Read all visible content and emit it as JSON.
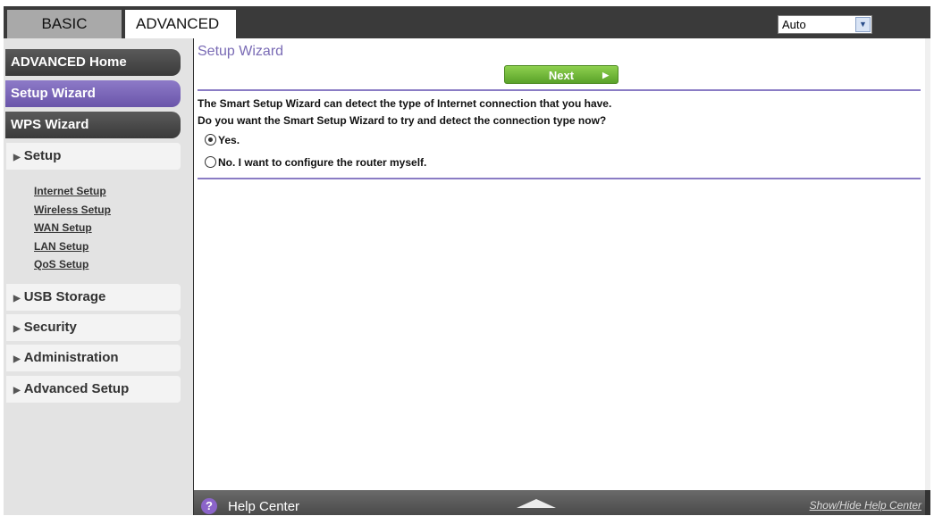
{
  "tabs": {
    "basic": "BASIC",
    "advanced": "ADVANCED"
  },
  "language_select": {
    "value": "Auto"
  },
  "sidebar": {
    "advanced_home": "ADVANCED Home",
    "setup_wizard": "Setup Wizard",
    "wps_wizard": "WPS Wizard",
    "setup": "Setup",
    "setup_items": [
      "Internet Setup",
      "Wireless Setup",
      "WAN Setup",
      "LAN Setup",
      "QoS Setup"
    ],
    "usb_storage": "USB Storage",
    "security": "Security",
    "administration": "Administration",
    "advanced_setup": "Advanced Setup"
  },
  "main": {
    "title": "Setup Wizard",
    "next_label": "Next",
    "description_1": "The Smart Setup Wizard can detect the type of Internet connection that you have.",
    "description_2": "Do you want the Smart Setup Wizard to try and detect the connection type now?",
    "options": [
      {
        "label": "Yes.",
        "selected": true
      },
      {
        "label": "No. I want to configure the router myself.",
        "selected": false
      }
    ]
  },
  "help": {
    "label": "Help Center",
    "toggle_label": "Show/Hide Help Center"
  },
  "colors": {
    "accent_purple": "#7a6bb5",
    "next_green": "#6bb536"
  }
}
